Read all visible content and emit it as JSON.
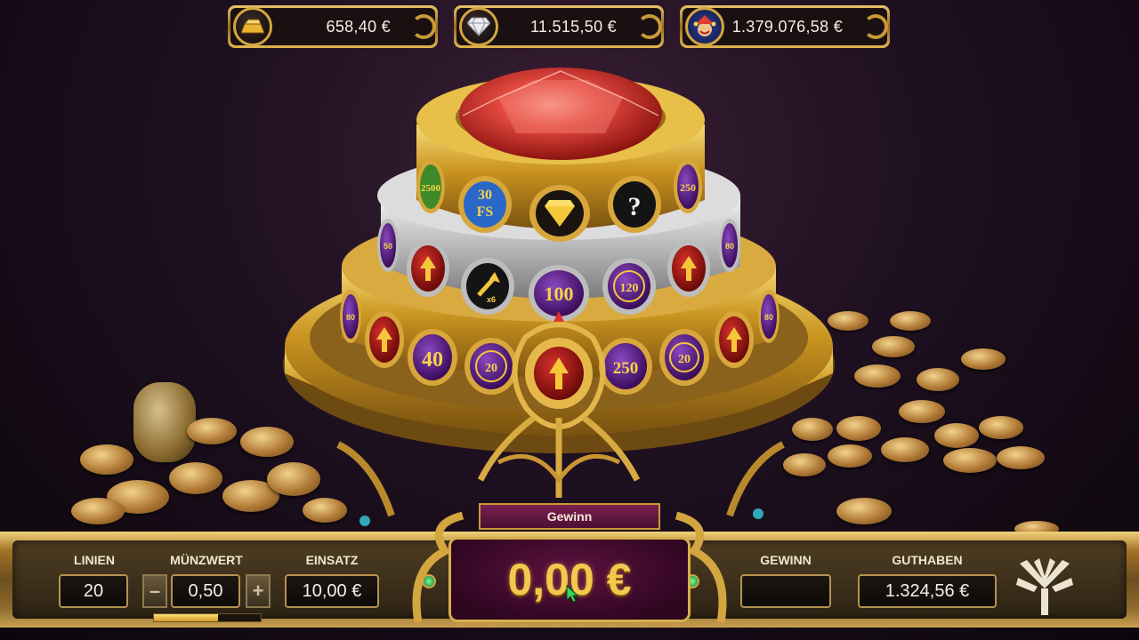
{
  "jackpots": [
    {
      "icon": "gold-bar-icon",
      "value": "658,40 €"
    },
    {
      "icon": "diamond-icon",
      "value": "11.515,50 €"
    },
    {
      "icon": "jester-icon",
      "value": "1.379.076,58 €"
    }
  ],
  "wheel": {
    "top_ring": [
      "2500",
      "30\nFS",
      "diamond-icon",
      "?",
      "250"
    ],
    "middle_ring": [
      "50",
      "arrow-up-icon",
      "x6",
      "100",
      "120",
      "arrow-up-icon",
      "80"
    ],
    "bottom_ring": [
      "80",
      "arrow-up-icon",
      "40",
      "20",
      "arrow-up-icon",
      "250",
      "20",
      "arrow-up-icon",
      "80"
    ]
  },
  "controls": {
    "lines_label": "LINIEN",
    "lines_value": "20",
    "coin_label": "MÜNZWERT",
    "coin_value": "0,50",
    "minus": "–",
    "plus": "+",
    "bet_label": "EINSATZ",
    "bet_value": "10,00 €",
    "win_tab_label": "Gewinn",
    "win_amount": "0,00 €",
    "win_label": "GEWINN",
    "win_value": "",
    "balance_label": "GUTHABEN",
    "balance_value": "1.324,56 €",
    "coin_slider_level": 0.6
  },
  "colors": {
    "gold": "#d4a640",
    "ruby": "#e0453c",
    "purple": "#5a1d7a"
  }
}
